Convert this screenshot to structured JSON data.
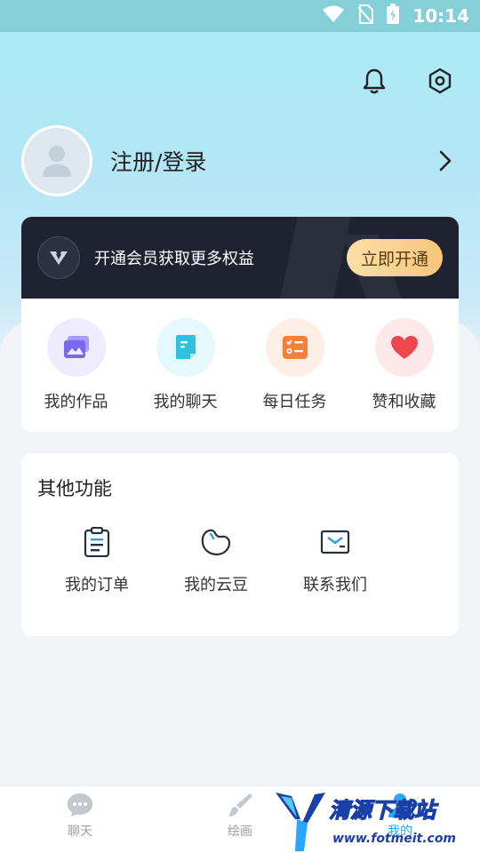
{
  "status_bar": {
    "time": "10:14"
  },
  "header": {
    "notifications_icon": "bell-icon",
    "settings_icon": "gear-icon"
  },
  "profile": {
    "login_label": "注册/登录"
  },
  "vip": {
    "text": "开通会员获取更多权益",
    "button": "立即开通",
    "badge_icon": "vip-v-icon"
  },
  "quick_actions": [
    {
      "label": "我的作品",
      "icon": "gallery-icon",
      "color": "#7a68f1",
      "bg": "#efecfd"
    },
    {
      "label": "我的聊天",
      "icon": "chat-doc-icon",
      "color": "#2fc1de",
      "bg": "#e5f8fb"
    },
    {
      "label": "每日任务",
      "icon": "task-list-icon",
      "color": "#f67f3c",
      "bg": "#fdefe6"
    },
    {
      "label": "赞和收藏",
      "icon": "heart-icon",
      "color": "#f0474f",
      "bg": "#fde9e9"
    }
  ],
  "other": {
    "title": "其他功能",
    "items": [
      {
        "label": "我的订单",
        "icon": "clipboard-icon"
      },
      {
        "label": "我的云豆",
        "icon": "bean-icon"
      },
      {
        "label": "联系我们",
        "icon": "mail-icon"
      }
    ]
  },
  "tabbar": [
    {
      "label": "聊天",
      "icon": "chat-bubble-icon"
    },
    {
      "label": "绘画",
      "icon": "brush-icon"
    },
    {
      "label": "我的",
      "icon": "user-icon"
    }
  ],
  "watermark": {
    "line1": "清源下载站",
    "line2": "www.fotmeit.com"
  }
}
